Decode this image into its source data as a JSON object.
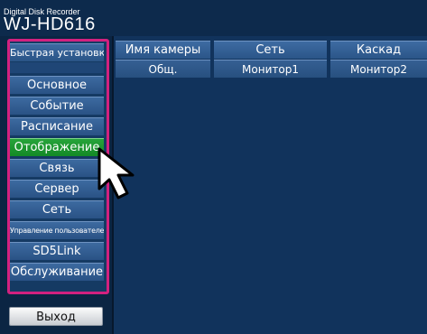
{
  "header": {
    "brand_line": "Digital Disk Recorder",
    "model": "WJ-HD616"
  },
  "sidebar": {
    "title": "Быстрая установка",
    "items": [
      {
        "label": "Основное"
      },
      {
        "label": "Событие"
      },
      {
        "label": "Расписание"
      },
      {
        "label": "Отображение"
      },
      {
        "label": "Связь"
      },
      {
        "label": "Сервер"
      },
      {
        "label": "Сеть"
      },
      {
        "label": "Управление пользователем"
      },
      {
        "label": "SD5Link"
      },
      {
        "label": "Обслуживание"
      }
    ],
    "active_item": "Отображение",
    "exit_label": "Выход"
  },
  "tabs": {
    "row1": [
      "Имя камеры",
      "Сеть",
      "Каскад"
    ],
    "row2": [
      "Общ.",
      "Монитор1",
      "Монитор2"
    ]
  },
  "colors": {
    "highlight_frame": "#d2217f",
    "active_item": "#26a33a",
    "background": "#0c2849"
  },
  "icons": {
    "cursor": "mouse-pointer-icon"
  }
}
